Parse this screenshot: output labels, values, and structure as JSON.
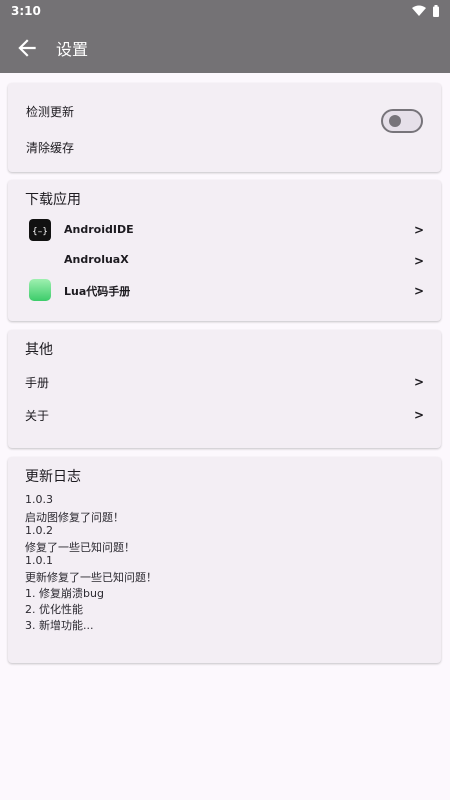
{
  "status_bar": {
    "time": "3:10"
  },
  "app_bar": {
    "title": "设置",
    "back_icon": "arrow-back-icon"
  },
  "general": {
    "check_update_label": "检测更新",
    "update_toggle_on": false,
    "clear_cache_label": "清除缓存"
  },
  "downloads": {
    "title": "下载应用",
    "apps": [
      {
        "name": "AndroidIDE",
        "icon": "androidide-icon",
        "chevron": ">"
      },
      {
        "name": "AndroluaX",
        "icon": "",
        "chevron": ">"
      },
      {
        "name": "Lua代码手册",
        "icon": "lua-manual-icon",
        "chevron": ">"
      }
    ]
  },
  "other": {
    "title": "其他",
    "items": [
      {
        "label": "手册",
        "chevron": ">"
      },
      {
        "label": "关于",
        "chevron": ">"
      }
    ]
  },
  "changelog": {
    "title": "更新日志",
    "lines": [
      "1.0.3",
      "启动图修复了问题！",
      "1.0.2",
      "修复了一些已知问题！",
      "1.0.1",
      "更新修复了一些已知问题！",
      "1. 修复崩溃bug",
      "2. 优化性能",
      "3. 新增功能..."
    ]
  },
  "colors": {
    "app_bar": "#747275",
    "background": "#fcf8fd",
    "card": "#f3eef4"
  }
}
